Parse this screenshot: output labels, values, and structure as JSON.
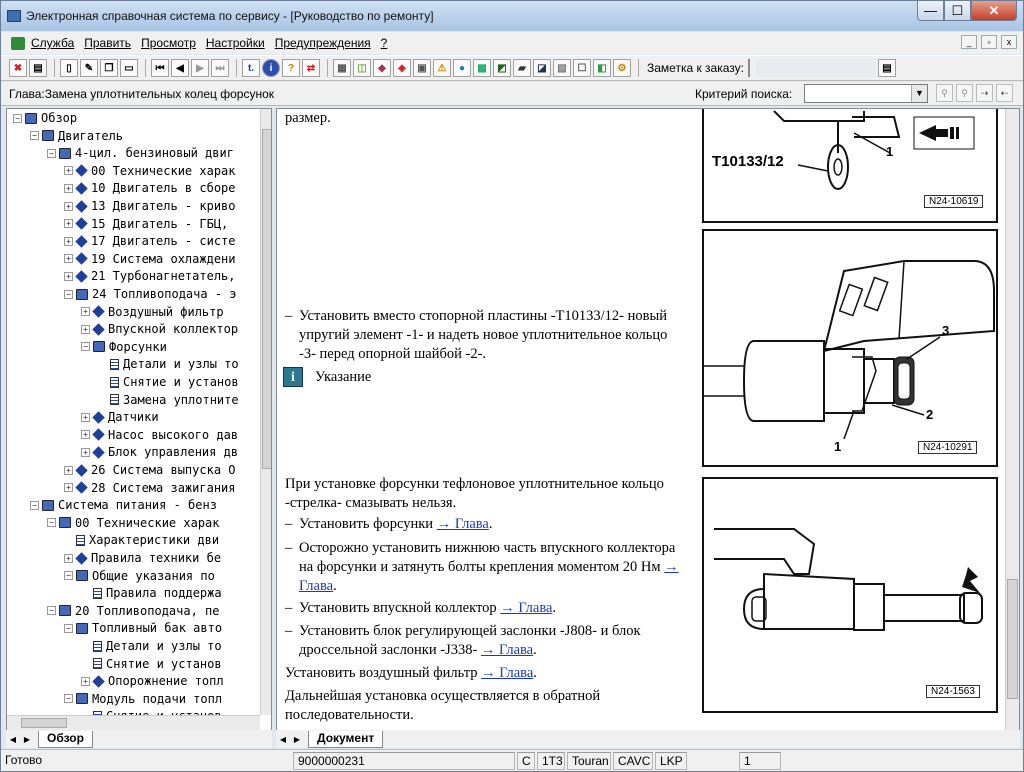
{
  "window": {
    "title": "Электронная справочная система по сервису - [Руководство по ремонту]",
    "btn_min": "—",
    "btn_max": "☐",
    "btn_close": "✕"
  },
  "menu": {
    "items": [
      "Служба",
      "Править",
      "Просмотр",
      "Настройки",
      "Предупреждения",
      "?"
    ]
  },
  "toolbar": {
    "note_label": "Заметка к заказу:",
    "btn_t": "t.",
    "btn_i": "i",
    "btn_q": "?"
  },
  "searchbar": {
    "chapter": "Глава:Замена уплотнительных колец форсунок",
    "criteria_label": "Критерий поиска:",
    "criteria_value": ""
  },
  "tree": {
    "items": [
      {
        "label": "Обзор",
        "exp": "−",
        "icon": "book-open"
      },
      {
        "label": "Двигатель",
        "exp": "−",
        "icon": "book-open"
      },
      {
        "label": "4-цил. бензиновый двиг",
        "exp": "−",
        "icon": "book-open"
      },
      {
        "label": "00 Технические харак",
        "exp": "+",
        "icon": "book"
      },
      {
        "label": "10 Двигатель в сборе",
        "exp": "+",
        "icon": "book"
      },
      {
        "label": "13 Двигатель - криво",
        "exp": "+",
        "icon": "book"
      },
      {
        "label": "15 Двигатель - ГБЦ,",
        "exp": "+",
        "icon": "book"
      },
      {
        "label": "17 Двигатель - систе",
        "exp": "+",
        "icon": "book"
      },
      {
        "label": "19 Система охлаждени",
        "exp": "+",
        "icon": "book"
      },
      {
        "label": "21 Турбонагнетатель,",
        "exp": "+",
        "icon": "book"
      },
      {
        "label": "24 Топливоподача - э",
        "exp": "−",
        "icon": "book-open"
      },
      {
        "label": "Воздушный фильтр",
        "exp": "+",
        "icon": "book"
      },
      {
        "label": "Впускной коллектор",
        "exp": "+",
        "icon": "book"
      },
      {
        "label": "Форсунки",
        "exp": "−",
        "icon": "book-open"
      },
      {
        "label": "Детали и узлы то",
        "exp": "",
        "icon": "doc"
      },
      {
        "label": "Снятие и установ",
        "exp": "",
        "icon": "doc"
      },
      {
        "label": "Замена уплотните",
        "exp": "",
        "icon": "doc"
      },
      {
        "label": "Датчики",
        "exp": "+",
        "icon": "book"
      },
      {
        "label": "Насос высокого дав",
        "exp": "+",
        "icon": "book"
      },
      {
        "label": "Блок управления дв",
        "exp": "+",
        "icon": "book"
      },
      {
        "label": "26 Система выпуска О",
        "exp": "+",
        "icon": "book"
      },
      {
        "label": "28 Система зажигания",
        "exp": "+",
        "icon": "book"
      },
      {
        "label": "Система питания - бенз",
        "exp": "−",
        "icon": "book-open"
      },
      {
        "label": "00 Технические харак",
        "exp": "−",
        "icon": "book-open"
      },
      {
        "label": "Характеристики дви",
        "exp": "",
        "icon": "doc"
      },
      {
        "label": "Правила техники бе",
        "exp": "+",
        "icon": "book"
      },
      {
        "label": "Общие указания по",
        "exp": "−",
        "icon": "book-open"
      },
      {
        "label": "Правила поддержа",
        "exp": "",
        "icon": "doc"
      },
      {
        "label": "20 Топливоподача, пе",
        "exp": "−",
        "icon": "book-open"
      },
      {
        "label": "Топливный бак авто",
        "exp": "−",
        "icon": "book-open"
      },
      {
        "label": "Детали и узлы то",
        "exp": "",
        "icon": "doc"
      },
      {
        "label": "Снятие и установ",
        "exp": "",
        "icon": "doc"
      },
      {
        "label": "Опорожнение топл",
        "exp": "+",
        "icon": "book"
      },
      {
        "label": "Модуль подачи топл",
        "exp": "−",
        "icon": "book-open"
      },
      {
        "label": "Снятие и установ",
        "exp": "",
        "icon": "doc"
      }
    ]
  },
  "tabs": {
    "left": "Обзор",
    "right": "Документ"
  },
  "document": {
    "p_top": "размер.",
    "step1": "Установить вместо стопорной пластины -T10133/12- новый упругий элемент -1- и надеть новое уплотнительное кольцо -3- перед опорной шайбой -2-.",
    "note_label": "Указание",
    "note_text": "При установке форсунки тефлоновое уплотнительное кольцо -стрелка- смазывать нельзя.",
    "step2": "Установить форсунки",
    "step3": "Осторожно установить нижнюю часть впускного коллектора на форсунки и затянуть болты крепления моментом 20 Нм",
    "step4": "Установить впускной коллектор",
    "step5": "Установить блок регулирующей заслонки -J808- и блок дроссельной заслонки -J338-",
    "p_filter": "Установить воздушный фильтр",
    "p_last": "Дальнейшая установка осуществляется в обратной последовательности.",
    "link": "→ Глава",
    "link_sep": ".",
    "fig1_tool": "T10133/12",
    "fig1_callout": "1",
    "fig1_id": "N24-10619",
    "fig2_c1": "1",
    "fig2_c2": "2",
    "fig2_c3": "3",
    "fig2_id": "N24-10291",
    "fig3_id": "N24-1563"
  },
  "status": {
    "ready": "Готово",
    "order": "9000000231",
    "c": "C",
    "code": "1T3",
    "model": "Touran",
    "engine": "CAVC",
    "kp": "LKP",
    "page": "1"
  }
}
